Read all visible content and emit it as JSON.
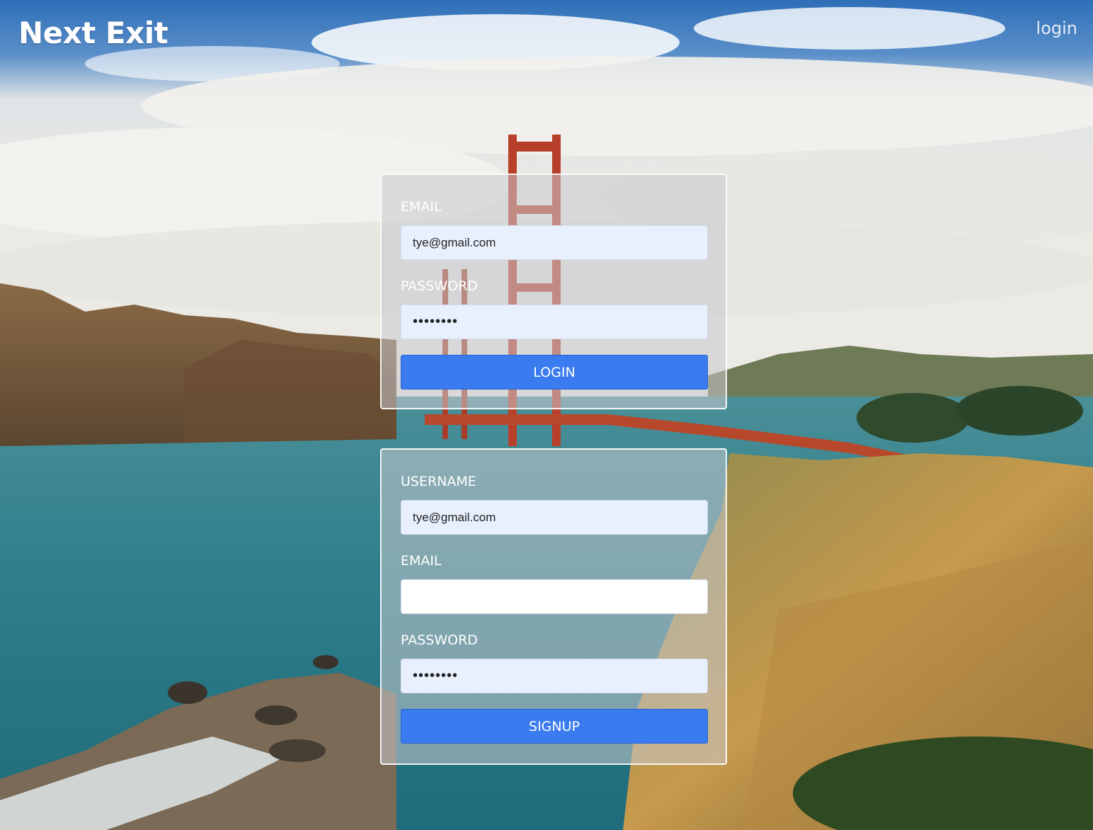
{
  "brand": {
    "title": "Next Exit"
  },
  "nav": {
    "login_link": "login"
  },
  "login_form": {
    "email_label": "EMAIL",
    "email_value": "tye@gmail.com",
    "password_label": "PASSWORD",
    "password_value": "password",
    "submit_label": "LOGIN"
  },
  "signup_form": {
    "username_label": "USERNAME",
    "username_value": "tye@gmail.com",
    "email_label": "EMAIL",
    "email_value": "",
    "password_label": "PASSWORD",
    "password_value": "password",
    "submit_label": "SIGNUP"
  },
  "colors": {
    "button_blue": "#3a7cf0",
    "autofill_bg": "#e8f0fe",
    "card_overlay": "#c8c8cd"
  }
}
